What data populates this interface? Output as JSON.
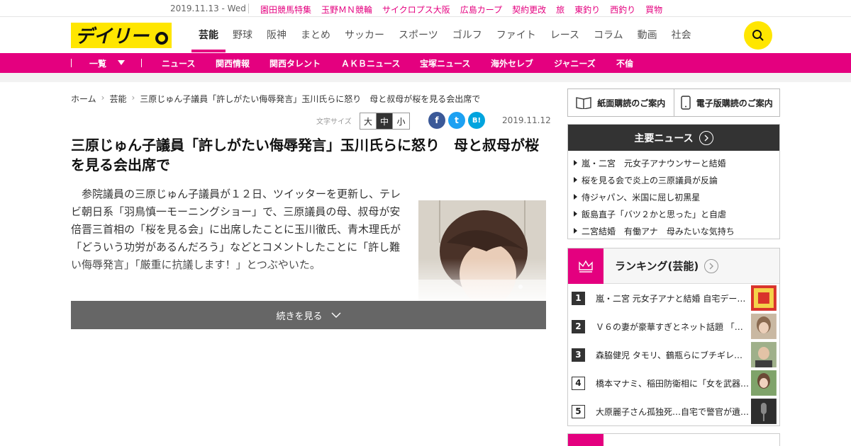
{
  "topbar": {
    "date": "2019.11.13 - Wed",
    "links": [
      "園田競馬特集",
      "玉野ＭＮ競輪",
      "サイクロプス大阪",
      "広島カープ",
      "契約更改",
      "旅",
      "東釣り",
      "西釣り",
      "買物"
    ]
  },
  "header": {
    "logo_text": "デイリー",
    "nav": [
      "芸能",
      "野球",
      "阪神",
      "まとめ",
      "サッカー",
      "スポーツ",
      "ゴルフ",
      "ファイト",
      "レース",
      "コラム",
      "動画",
      "社会"
    ],
    "active_nav": "芸能"
  },
  "subnav": {
    "list_label": "一覧",
    "items": [
      "ニュース",
      "関西情報",
      "関西タレント",
      "ＡＫＢニュース",
      "宝塚ニュース",
      "海外セレブ",
      "ジャニーズ",
      "不倫"
    ]
  },
  "breadcrumb": [
    "ホーム",
    "芸能",
    "三原じゅん子議員「許しがたい侮辱発言」玉川氏らに怒り　母と叔母が桜を見る会出席で"
  ],
  "tools": {
    "fontsize_label": "文字サイズ",
    "sizes": [
      "大",
      "中",
      "小"
    ],
    "selected_size": "中",
    "share": [
      {
        "label": "f",
        "color": "#3b5998"
      },
      {
        "label": "t",
        "color": "#1da1f2"
      },
      {
        "label": "B!",
        "color": "#00a4de"
      }
    ],
    "date": "2019.11.12"
  },
  "article": {
    "headline": "三原じゅん子議員「許しがたい侮辱発言」玉川氏らに怒り　母と叔母が桜を見る会出席で",
    "body": "　参院議員の三原じゅん子議員が１２日、ツイッターを更新し、テレビ朝日系「羽鳥慎一モーニングショー」で、三原議員の母、叔母が安倍晋三首相の「桜を見る会」に出席したことに玉川徹氏、青木理氏が「どういう功労があるんだろう」などとコメントしたことに「許し難い侮辱発言」「厳重に抗議します！」とつぶやいた。",
    "more_label": "続きを見る"
  },
  "sidebar": {
    "subscribe": [
      "紙面購読のご案内",
      "電子版購読のご案内"
    ],
    "news_title": "主要ニュース",
    "news": [
      "嵐・二宮　元女子アナウンサーと結婚",
      "桜を見る会で炎上の三原議員が反論",
      "侍ジャパン、米国に屈し初黒星",
      "飯島直子「バツ２かと思った」と自虐",
      "二宮結婚　有働アナ　母みたいな気持ち"
    ],
    "ranking_title": "ランキング(芸能)",
    "ranking": [
      {
        "rank": "1",
        "text": "嵐・二宮 元女子アナと結婚 自宅デー…",
        "thumb_color": "#d9332b"
      },
      {
        "rank": "2",
        "text": "Ｖ６の妻が豪華すぎとネット話題 「…",
        "thumb_color": "#8a6a50"
      },
      {
        "rank": "3",
        "text": "森脇健児 タモリ、鶴瓶らにブチギレ…",
        "thumb_color": "#6d7e5a"
      },
      {
        "rank": "4",
        "text": "橋本マナミ、稲田防衛相に「女を武器…",
        "thumb_color": "#b58a6e"
      },
      {
        "rank": "5",
        "text": "大原麗子さん孤独死…自宅で警官が遺…",
        "thumb_color": "#2e2e2e"
      }
    ]
  },
  "colors": {
    "brand_pink": "#e4007f",
    "logo_yellow": "#ffe600",
    "dark": "#333333"
  }
}
